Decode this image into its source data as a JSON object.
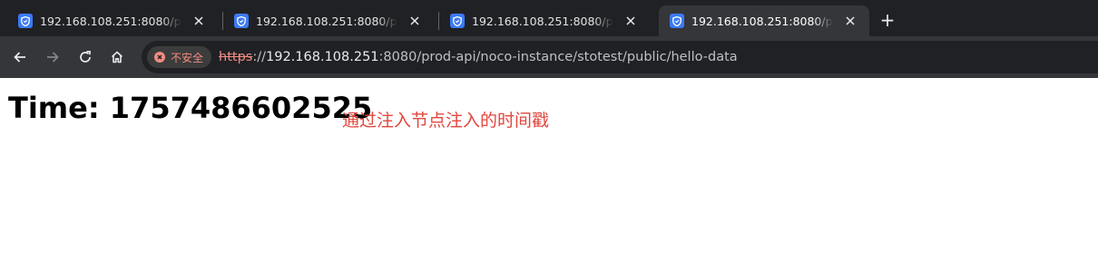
{
  "tabs": [
    {
      "title": "192.168.108.251:8080/prod-api/noco-instance/stotest/public/hello-data",
      "active": false
    },
    {
      "title": "192.168.108.251:8080/prod-api/noco-instance/stotest/public/hello-data",
      "active": false
    },
    {
      "title": "192.168.108.251:8080/prod-api/noco-instance/stotest/public/hello-data",
      "active": false
    },
    {
      "title": "192.168.108.251:8080/prod-api/noco-instance/stotest/public/hello-data",
      "active": true
    }
  ],
  "new_tab_label": "+",
  "toolbar": {
    "security_label": "不安全",
    "url_scheme": "https",
    "url_sep": "://",
    "url_host": "192.168.108.251",
    "url_rest": ":8080/prod-api/noco-instance/stotest/public/hello-data"
  },
  "page": {
    "heading": "Time: 1757486602525",
    "note": "通过注入节点注入的时间戳"
  },
  "colors": {
    "tabstrip_bg": "#202124",
    "toolbar_bg": "#35363a",
    "favicon": "#3b7af5",
    "insecure": "#f28b82",
    "note_text": "#e0473e"
  },
  "icons": [
    "shield-favicon-icon",
    "close-icon",
    "plus-icon",
    "back-arrow-icon",
    "forward-arrow-icon",
    "reload-icon",
    "home-icon",
    "not-secure-icon"
  ]
}
